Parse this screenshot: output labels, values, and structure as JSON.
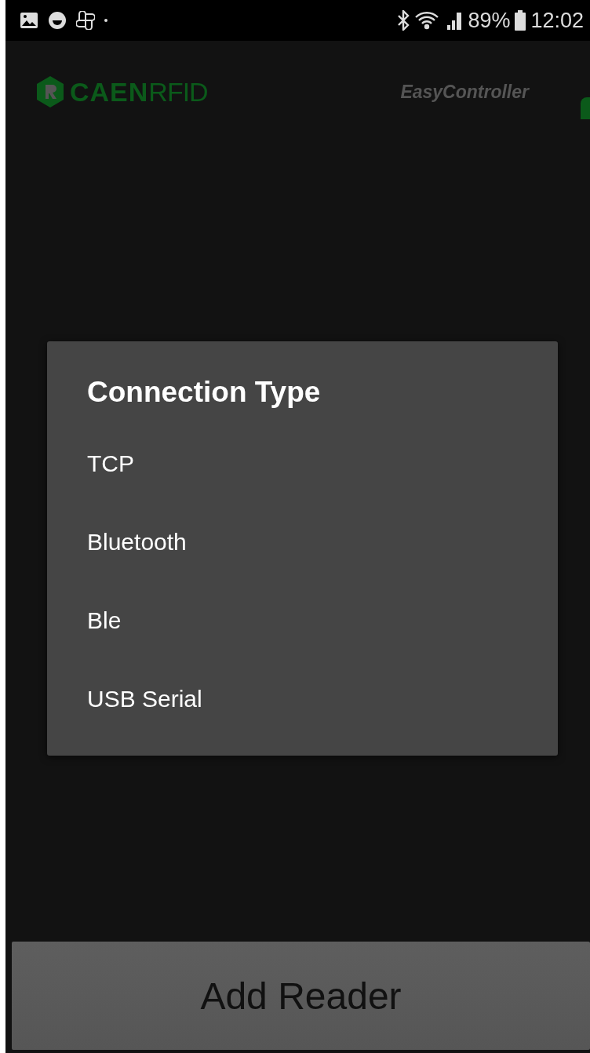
{
  "status_bar": {
    "battery": "89%",
    "time": "12:02"
  },
  "header": {
    "logo": {
      "brand": "CAEN",
      "suffix": "RFID"
    },
    "app_name": "EasyController"
  },
  "dialog": {
    "title": "Connection Type",
    "options": [
      {
        "label": "TCP"
      },
      {
        "label": "Bluetooth"
      },
      {
        "label": "Ble"
      },
      {
        "label": "USB Serial"
      }
    ]
  },
  "button": {
    "label": "Add Reader"
  }
}
